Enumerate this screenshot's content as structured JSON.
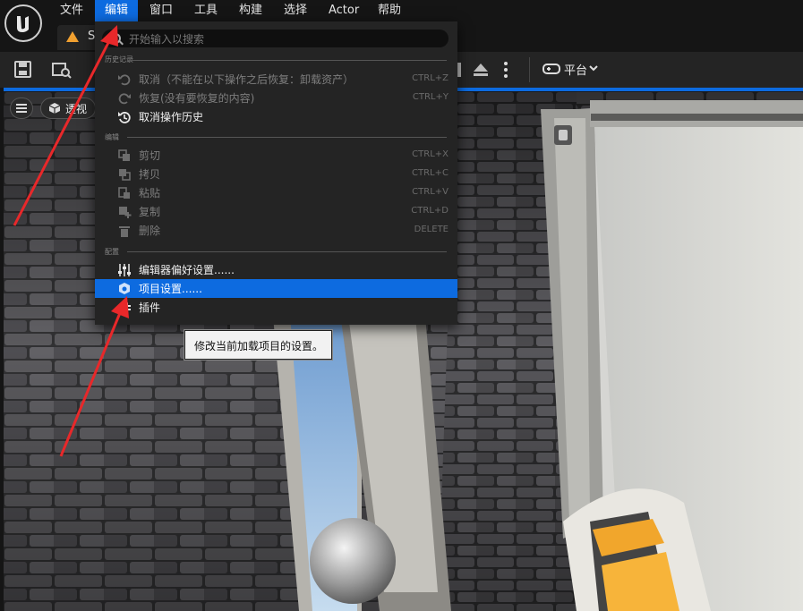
{
  "menubar": {
    "items": [
      "文件",
      "编辑",
      "窗口",
      "工具",
      "构建",
      "选择",
      "Actor",
      "帮助"
    ],
    "active": "编辑"
  },
  "tab": {
    "title": "S"
  },
  "toolbar": {
    "platform_label": "平台"
  },
  "viewport": {
    "view_mode_label": "透视"
  },
  "edit_menu": {
    "search_placeholder": "开始输入以搜索",
    "sections": {
      "history": "历史记录",
      "edit": "编辑",
      "config": "配置"
    },
    "history_items": [
      {
        "label": "取消（不能在以下操作之后恢复：卸载资产）",
        "shortcut": "CTRL+Z",
        "enabled": false,
        "icon": "undo-icon"
      },
      {
        "label": "恢复(没有要恢复的内容)",
        "shortcut": "CTRL+Y",
        "enabled": false,
        "icon": "redo-icon"
      },
      {
        "label": "取消操作历史",
        "shortcut": "",
        "enabled": true,
        "icon": "history-icon"
      }
    ],
    "edit_items": [
      {
        "label": "剪切",
        "shortcut": "CTRL+X",
        "enabled": false,
        "icon": "cut-icon"
      },
      {
        "label": "拷贝",
        "shortcut": "CTRL+C",
        "enabled": false,
        "icon": "copy-icon"
      },
      {
        "label": "粘贴",
        "shortcut": "CTRL+V",
        "enabled": false,
        "icon": "paste-icon"
      },
      {
        "label": "复制",
        "shortcut": "CTRL+D",
        "enabled": false,
        "icon": "duplicate-icon"
      },
      {
        "label": "删除",
        "shortcut": "DELETE",
        "enabled": false,
        "icon": "trash-icon"
      }
    ],
    "config_items": [
      {
        "label": "编辑器偏好设置......",
        "enabled": true,
        "icon": "sliders-icon"
      },
      {
        "label": "项目设置......",
        "enabled": true,
        "highlighted": true,
        "icon": "project-settings-icon"
      },
      {
        "label": "插件",
        "enabled": true,
        "icon": "plugin-icon"
      }
    ]
  },
  "tooltip": {
    "text": "修改当前加载项目的设置。"
  },
  "colors": {
    "accent": "#0d6be0",
    "annotation": "#e8282a",
    "tab_icon": "#f0a030"
  }
}
